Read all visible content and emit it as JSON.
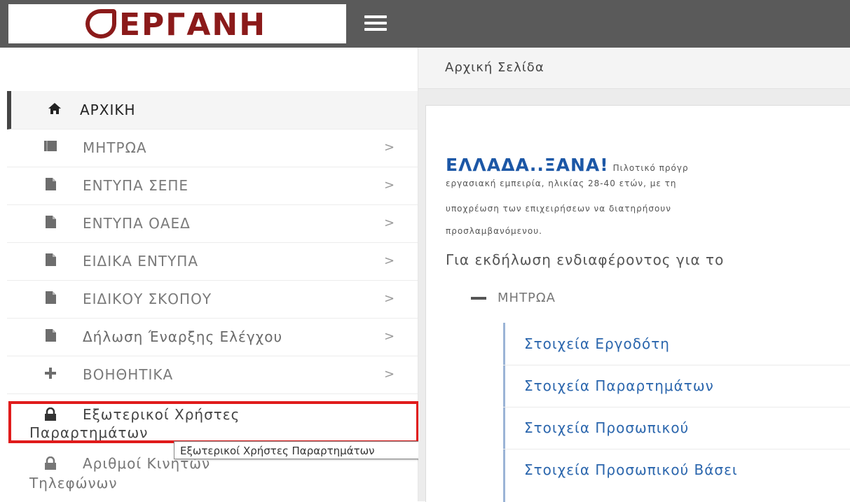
{
  "header": {
    "logo_text": "ΕΡΓΑΝΗ",
    "menu_toggle": "menu-icon"
  },
  "sidebar": {
    "items": [
      {
        "label": "ΑΡΧΙΚΗ",
        "icon": "home-icon",
        "active": true
      },
      {
        "label": "ΜΗΤΡΩΑ",
        "icon": "book-icon",
        "chevron": ">"
      },
      {
        "label": "ΕΝΤΥΠΑ ΣΕΠΕ",
        "icon": "file-icon",
        "chevron": ">"
      },
      {
        "label": "ΕΝΤΥΠΑ ΟΑΕΔ",
        "icon": "file-icon",
        "chevron": ">"
      },
      {
        "label": "ΕΙΔΙΚΑ ΕΝΤΥΠΑ",
        "icon": "file-icon",
        "chevron": ">"
      },
      {
        "label": "ΕΙΔΙΚΟΥ ΣΚΟΠΟΥ",
        "icon": "file-icon",
        "chevron": ">"
      },
      {
        "label": "Δήλωση Έναρξης Ελέγχου",
        "icon": "file-icon",
        "chevron": ">"
      },
      {
        "label": "ΒΟΗΘΗΤΙΚΑ",
        "icon": "plus-icon",
        "chevron": ">"
      }
    ],
    "external_users": {
      "line1": "Εξωτερικοί Χρήστες",
      "line2": "Παραρτημάτων",
      "icon": "lock-icon"
    },
    "mobile_numbers": {
      "line1": "Αριθμοί Κινητών",
      "line2": "Τηλεφώνων",
      "icon": "lock-icon"
    },
    "tooltip": "Εξωτερικοί Χρήστες Παραρτημάτων"
  },
  "main": {
    "breadcrumb": "Αρχική Σελίδα",
    "headline": "ΕΛΛΑΔΑ..ΞΑΝΑ!",
    "headline_tail": "Πιλοτικό πρόγρ",
    "paragraph_lines": [
      "εργασιακή εμπειρία, ηλικίας 28-40 ετών, με τη",
      "υποχρέωση των επιχειρήσεων να διατηρήσουν",
      "προσλαμβανόμενου."
    ],
    "interest_text": "Για εκδήλωση ενδιαφέροντος για το",
    "tree": {
      "root_label": "ΜΗΤΡΩΑ",
      "links": [
        "Στοιχεία Εργοδότη",
        "Στοιχεία Παραρτημάτων",
        "Στοιχεία Προσωπικού",
        "Στοιχεία Προσωπικού Βάσει"
      ]
    }
  },
  "colors": {
    "topbar": "#5a5a5a",
    "logo": "#8b1a1a",
    "headline": "#1c57a6",
    "link": "#2b66ad",
    "highlight": "#e01b1b"
  }
}
